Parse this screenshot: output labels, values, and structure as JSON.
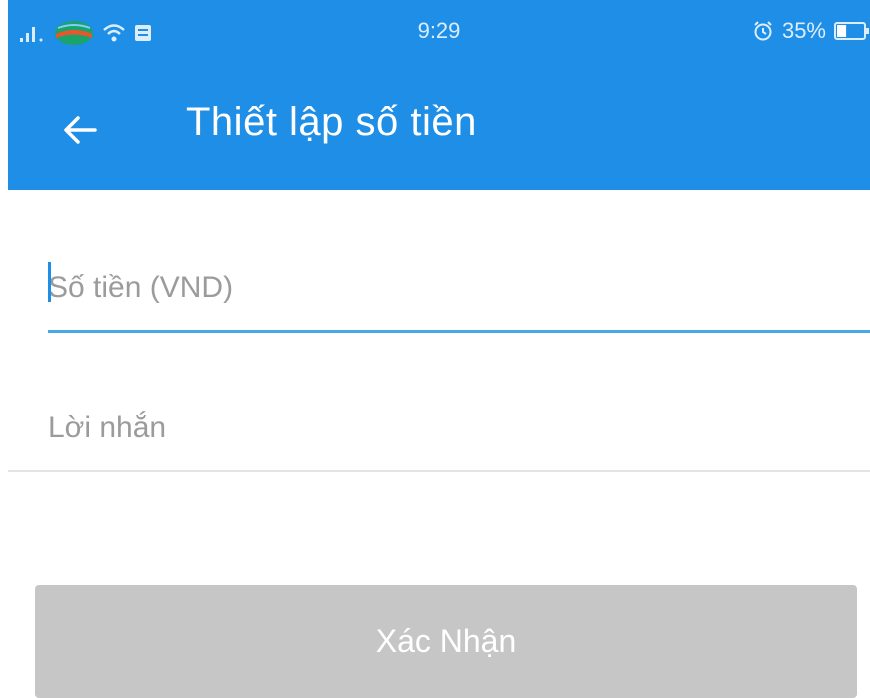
{
  "status_bar": {
    "time": "9:29",
    "battery_percent": "35%",
    "battery_level": 0.35,
    "icons": [
      "signal-icon",
      "carrier-logo-icon",
      "wifi-icon",
      "notification-icon",
      "alarm-icon",
      "battery-icon"
    ]
  },
  "app_bar": {
    "title": "Thiết lập số tiền",
    "back_icon": "arrow-left-icon"
  },
  "form": {
    "amount": {
      "value": "",
      "placeholder": "Số tiền (VND)"
    },
    "message": {
      "value": "",
      "placeholder": "Lời nhắn"
    }
  },
  "actions": {
    "confirm_label": "Xác Nhận"
  },
  "colors": {
    "primary": "#1f8ee6",
    "input_focus_underline": "#48a7e9",
    "button_disabled": "#c6c6c6",
    "divider": "#e4e4e4",
    "placeholder": "#9b9b9b"
  }
}
